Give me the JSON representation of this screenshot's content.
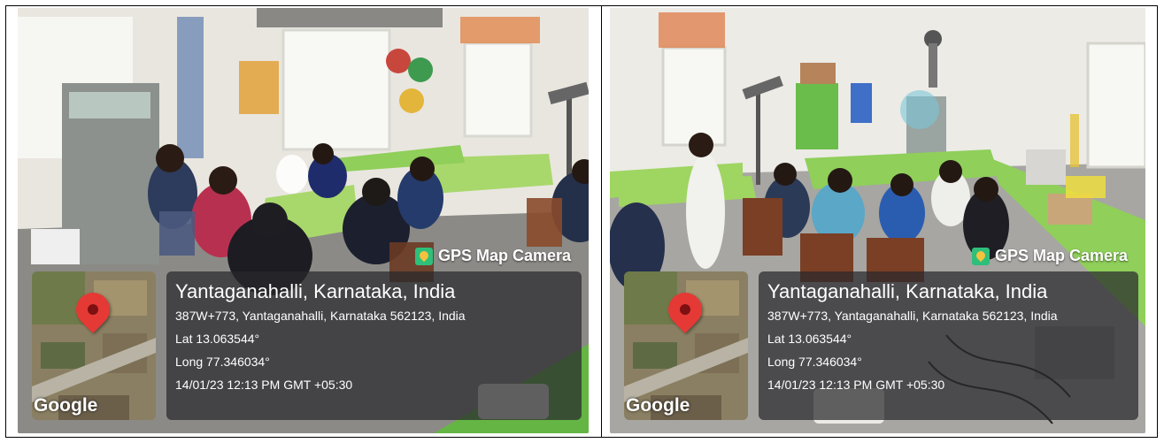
{
  "photos": [
    {
      "badge": "GPS Map Camera",
      "google": "Google",
      "place": "Yantaganahalli, Karnataka, India",
      "address": "387W+773, Yantaganahalli, Karnataka 562123, India",
      "lat": "Lat 13.063544°",
      "long": "Long 77.346034°",
      "timestamp": "14/01/23 12:13 PM GMT +05:30"
    },
    {
      "badge": "GPS Map Camera",
      "google": "Google",
      "place": "Yantaganahalli, Karnataka, India",
      "address": "387W+773, Yantaganahalli, Karnataka 562123, India",
      "lat": "Lat 13.063544°",
      "long": "Long 77.346034°",
      "timestamp": "14/01/23 12:13 PM GMT +05:30"
    }
  ]
}
